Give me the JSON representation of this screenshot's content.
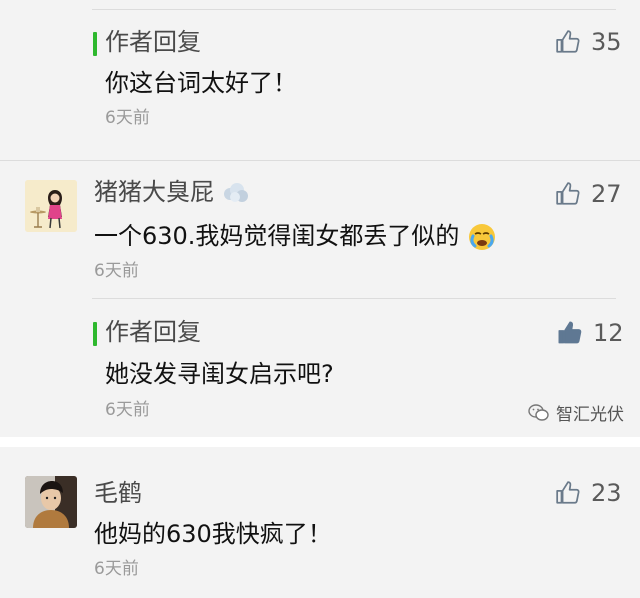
{
  "comments": [
    {
      "reply_label": "作者回复",
      "content": "你这台词太好了！",
      "time": "6天前",
      "likes": "35",
      "liked": false
    },
    {
      "author": "猪猪大臭屁",
      "avatar_icon": "avatar-girl-at-table",
      "content": "一个630.我妈觉得闺女都丢了似的",
      "content_emoji": "crying-face-emoji",
      "time": "6天前",
      "likes": "27",
      "liked": false,
      "reply": {
        "reply_label": "作者回复",
        "content": "她没发寻闺女启示吧?",
        "time": "6天前",
        "likes": "12",
        "liked": true
      }
    },
    {
      "author": "毛鹤",
      "avatar_icon": "avatar-photo-man",
      "content": "他妈的630我快疯了！",
      "time": "6天前",
      "likes": "23",
      "liked": false
    }
  ],
  "watermark": {
    "text": "智汇光伏",
    "icon": "wechat-icon"
  },
  "colors": {
    "reply_bar": "#2eb82e",
    "like_outline": "#6a7a8a",
    "like_filled": "#5f7893",
    "time": "#9a9a9a",
    "author": "#4a4a4a"
  }
}
